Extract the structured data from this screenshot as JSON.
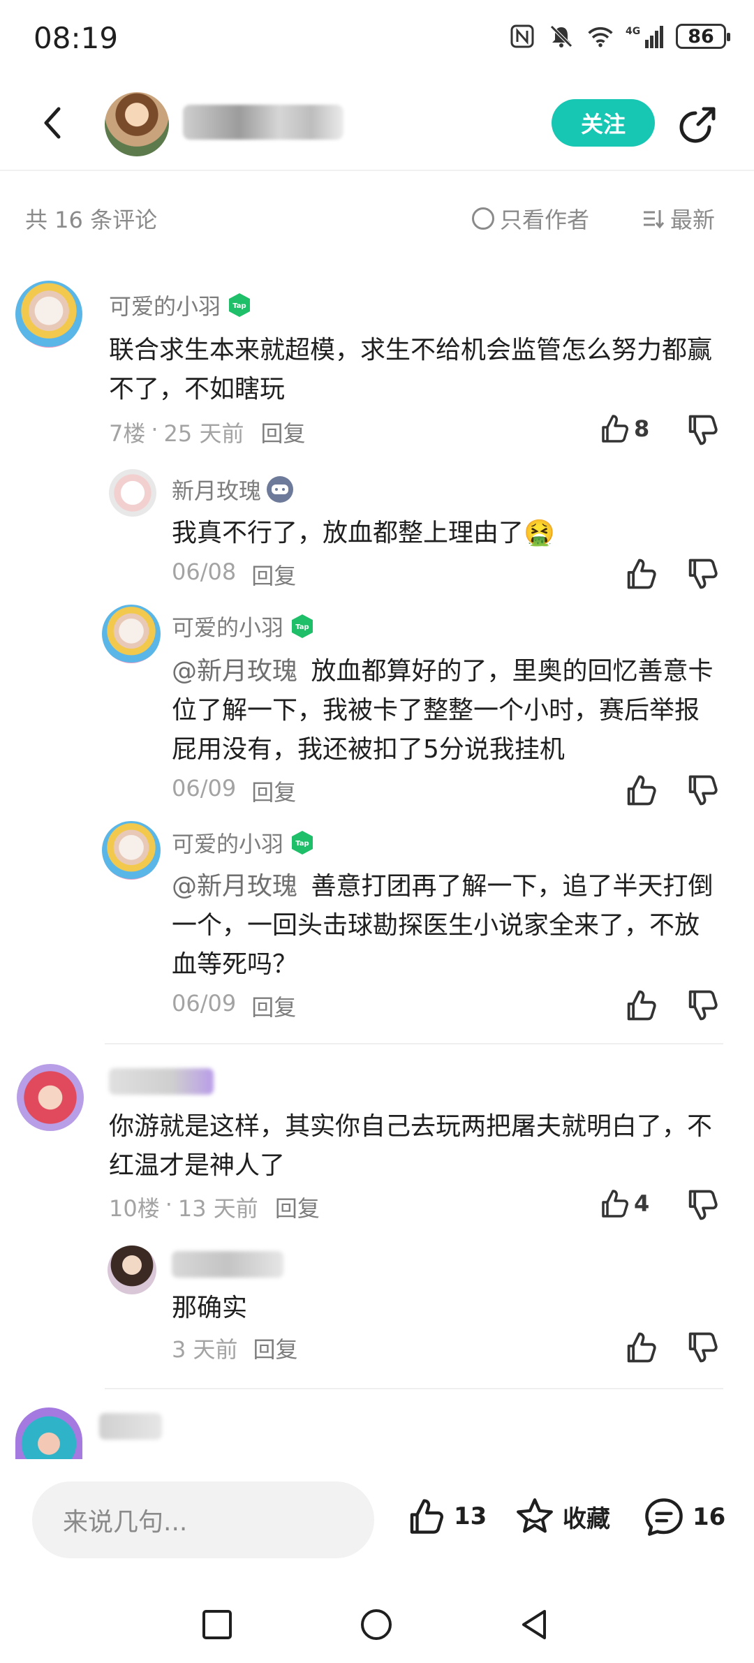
{
  "status_bar": {
    "time": "08:19",
    "battery": "86",
    "network": "4G"
  },
  "header": {
    "follow_label": "关注"
  },
  "comments_header": {
    "count_text": "共 16 条评论",
    "author_only_label": "只看作者",
    "sort_label": "最新"
  },
  "comments": [
    {
      "name": "可爱的小羽",
      "text": "联合求生本来就超模，求生不给机会监管怎么努力都赢不了，不如瞎玩",
      "floor": "7楼",
      "time": "25 天前",
      "reply_label": "回复",
      "likes": "8",
      "replies": [
        {
          "name": "新月玫瑰",
          "text": "我真不行了，放血都整上理由了🤮",
          "time": "06/08",
          "reply_label": "回复"
        },
        {
          "name": "可爱的小羽",
          "mention": "@新月玫瑰",
          "text": "放血都算好的了，里奥的回忆善意卡位了解一下，我被卡了整整一个小时，赛后举报屁用没有，我还被扣了5分说我挂机",
          "time": "06/09",
          "reply_label": "回复"
        },
        {
          "name": "可爱的小羽",
          "mention": "@新月玫瑰",
          "text": "善意打团再了解一下，追了半天打倒一个，一回头击球勘探医生小说家全来了，不放血等死吗？",
          "time": "06/09",
          "reply_label": "回复"
        }
      ]
    },
    {
      "text": "你游就是这样，其实你自己去玩两把屠夫就明白了，不红温才是神人了",
      "floor": "10楼",
      "time": "13 天前",
      "reply_label": "回复",
      "likes": "4",
      "replies": [
        {
          "text": "那确实",
          "time": "3 天前",
          "reply_label": "回复"
        }
      ]
    }
  ],
  "bottom_bar": {
    "input_placeholder": "来说几句...",
    "like_count": "13",
    "favorite_label": "收藏",
    "comment_count": "16"
  },
  "colors": {
    "accent": "#17c6b3",
    "text_primary": "#1f1f1f",
    "text_secondary": "#8a8a8a"
  },
  "icons": [
    "back-icon",
    "share-icon",
    "like-icon",
    "dislike-icon",
    "star-icon",
    "comment-icon",
    "tap-badge-icon",
    "game-badge-icon"
  ]
}
